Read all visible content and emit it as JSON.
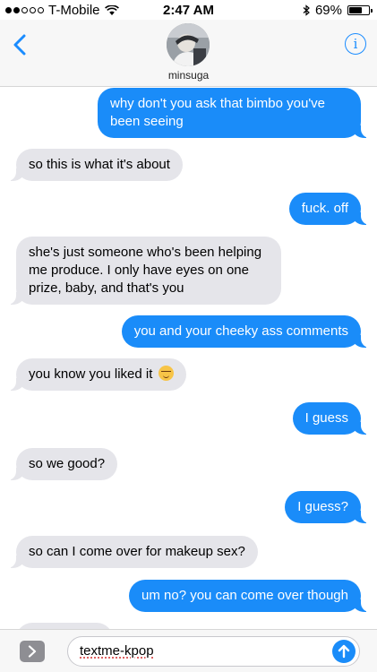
{
  "status_bar": {
    "carrier": "T-Mobile",
    "time": "2:47 AM",
    "battery_percent": "69%",
    "battery_level": 0.69,
    "signal_bars_filled": 2,
    "signal_bars_total": 5
  },
  "header": {
    "contact_name": "minsuga",
    "info_label": "i"
  },
  "messages": [
    {
      "direction": "sent",
      "text": "why don't you ask that bimbo you've been seeing"
    },
    {
      "direction": "received",
      "text": "so this is what it's about"
    },
    {
      "direction": "sent",
      "text": "fuck. off"
    },
    {
      "direction": "received",
      "text": "she's just someone who's been helping me produce. I only have eyes on one prize, baby, and that's you"
    },
    {
      "direction": "sent",
      "text": "you and your cheeky ass comments"
    },
    {
      "direction": "received",
      "text": "you know you liked it",
      "emoji": "smirking-face"
    },
    {
      "direction": "sent",
      "text": "I guess"
    },
    {
      "direction": "received",
      "text": "so we good?"
    },
    {
      "direction": "sent",
      "text": "I guess?"
    },
    {
      "direction": "received",
      "text": "so can I come over for makeup sex?"
    },
    {
      "direction": "sent",
      "text": "um no? you can come over though"
    }
  ],
  "compose": {
    "value": "textme-kpop"
  },
  "colors": {
    "sent_bubble": "#1a8cf9",
    "received_bubble": "#e5e5ea",
    "accent": "#1a8cff"
  }
}
